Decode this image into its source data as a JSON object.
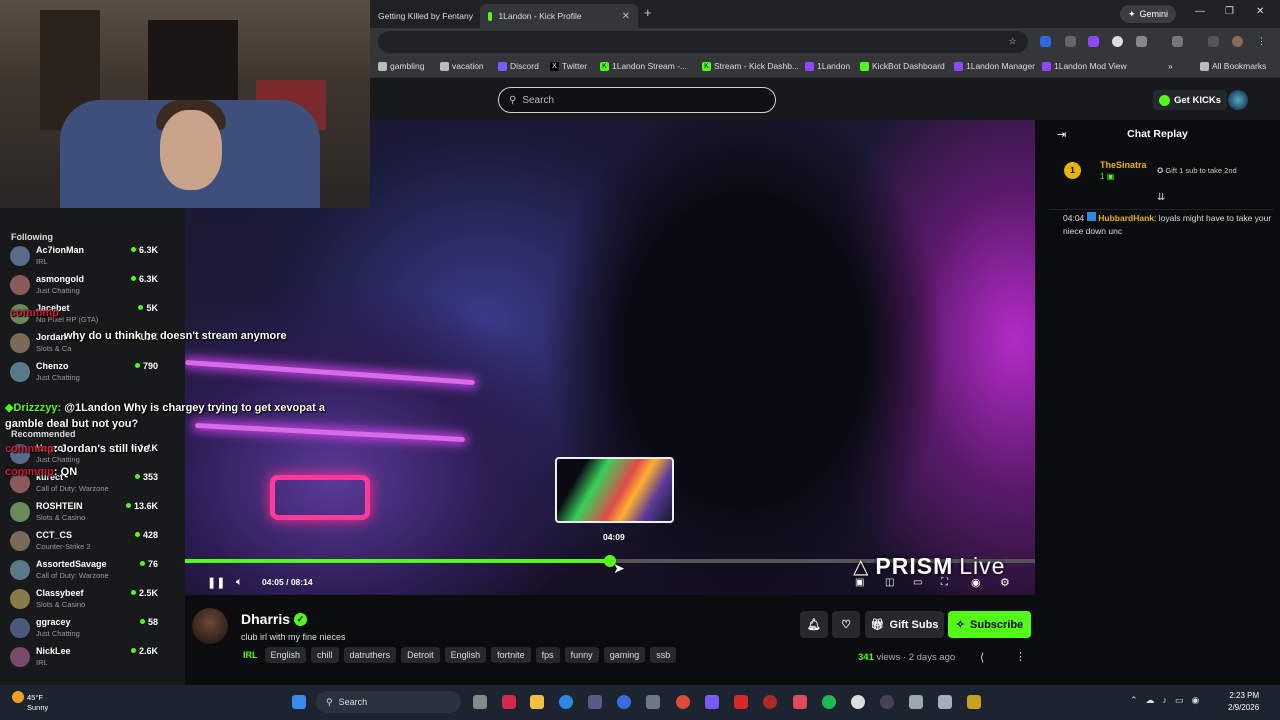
{
  "browser": {
    "tabs": [
      {
        "label": "Getting Killed by Fentany"
      },
      {
        "label": "1Landon - Kick Profile"
      }
    ],
    "gemini_label": "Gemini",
    "bookmarks": [
      {
        "label": "gambling",
        "icon": "folder-icon",
        "color": "#bbbbbb"
      },
      {
        "label": "vacation",
        "icon": "folder-icon",
        "color": "#bbbbbb"
      },
      {
        "label": "Discord",
        "icon": "discord-icon",
        "color": "#7a5af8"
      },
      {
        "label": "Twitter",
        "icon": "x-icon",
        "color": "#000000"
      },
      {
        "label": "1Landon Stream -...",
        "icon": "kick-icon",
        "color": "#53fc18"
      },
      {
        "label": "Stream - Kick Dashb...",
        "icon": "kick-icon",
        "color": "#53fc18"
      },
      {
        "label": "1Landon",
        "icon": "twitch-icon",
        "color": "#9146ff"
      },
      {
        "label": "KickBot Dashboard",
        "icon": "kickbot-icon",
        "color": "#53fc18"
      },
      {
        "label": "1Landon Manager",
        "icon": "twitch-icon",
        "color": "#9146ff"
      },
      {
        "label": "1Landon Mod View",
        "icon": "twitch-icon",
        "color": "#9146ff"
      }
    ],
    "all_bookmarks": "All Bookmarks"
  },
  "kick": {
    "search_placeholder": "Search",
    "get_kicks": "Get KICKs",
    "accent": "#53fc18"
  },
  "sidebar": {
    "following_title": "Following",
    "following": [
      {
        "name": "Ac7ionMan",
        "category": "IRL",
        "viewers": "6.3K"
      },
      {
        "name": "asmongold",
        "category": "Just Chatting",
        "viewers": "6.3K"
      },
      {
        "name": "Jacebet",
        "category": "No Pixel RP (GTA)",
        "viewers": "5K"
      },
      {
        "name": "Jordan",
        "category": "Slots & Ca",
        "viewers": "1.2K"
      },
      {
        "name": "Chenzo",
        "category": "Just Chatting",
        "viewers": "790"
      }
    ],
    "recommended_title": "Recommended",
    "recommended": [
      {
        "name": "Hanzo",
        "category": "Just Chatting",
        "viewers": "1.1K"
      },
      {
        "name": "kurect",
        "category": "Call of Duty: Warzone",
        "viewers": "353"
      },
      {
        "name": "ROSHTEIN",
        "category": "Slots & Casino",
        "viewers": "13.6K"
      },
      {
        "name": "CCT_CS",
        "category": "Counter-Strike 2",
        "viewers": "428"
      },
      {
        "name": "AssortedSavage",
        "category": "Call of Duty: Warzone",
        "viewers": "76"
      },
      {
        "name": "Classybeef",
        "category": "Slots & Casino",
        "viewers": "2.5K"
      },
      {
        "name": "ggracey",
        "category": "Just Chatting",
        "viewers": "58"
      },
      {
        "name": "NickLee",
        "category": "IRL",
        "viewers": "2.6K"
      }
    ]
  },
  "overlay_chat": [
    {
      "user": "commmp",
      "text": "why do u think he doesn't stream anymore"
    },
    {
      "user": "Drizzzyy",
      "text": "@1Landon Why is chargey trying to get xevopat a"
    },
    {
      "user": "",
      "text": "gamble deal but not you?"
    },
    {
      "user": "commmp",
      "text": "Jordan's still live"
    },
    {
      "user": "commmp",
      "text": "QN"
    }
  ],
  "player": {
    "time_current": "04:05",
    "time_total": "08:14",
    "time_display": "04:05 / 08:14",
    "hover_time": "04:09",
    "progress": 0.5,
    "watermark": "PRISM",
    "watermark_suffix": "Live"
  },
  "channel": {
    "name": "Dharris",
    "title": "club irl with my fine nieces",
    "category": "IRL",
    "tags": [
      "English",
      "chill",
      "datruthers",
      "Detroit",
      "English",
      "fortnite",
      "fps",
      "funny",
      "gaming",
      "ssb"
    ],
    "gift_subs": "Gift Subs",
    "subscribe": "Subscribe",
    "views": "341",
    "views_label": "views",
    "age": "2 days ago"
  },
  "chat": {
    "title": "Chat Replay",
    "pinned": {
      "rank": "1",
      "name": "TheSinatra",
      "count": "1",
      "text": "Gift 1 sub to take 2nd"
    },
    "messages": [
      {
        "time": "04:04",
        "user": "HubbardHank",
        "text": "loyals might have to take your niece down unc"
      }
    ]
  },
  "taskbar": {
    "temp": "45°F",
    "weather": "Sunny",
    "search": "Search",
    "time": "2:23 PM",
    "date": "2/9/2026"
  }
}
